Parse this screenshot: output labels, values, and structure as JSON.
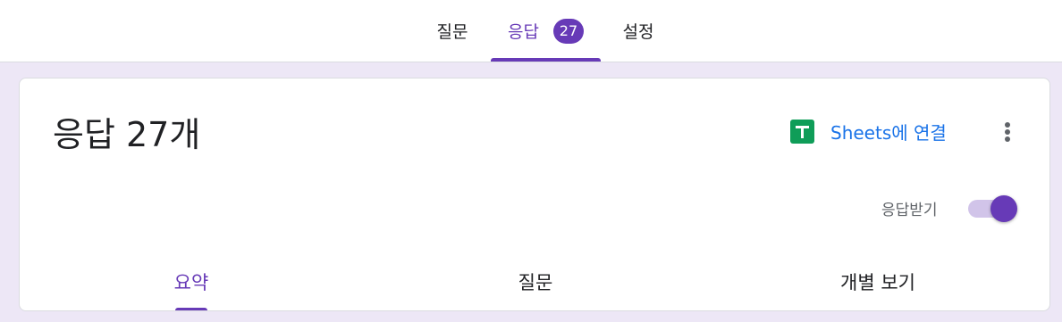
{
  "top_tabs": [
    {
      "label": "질문"
    },
    {
      "label": "응답",
      "badge": "27",
      "active": true
    },
    {
      "label": "설정"
    }
  ],
  "card": {
    "title": "응답 27개",
    "sheets_link": {
      "icon": "google-sheets-icon",
      "label": "Sheets에 연결"
    },
    "more_icon": "more-vert-icon",
    "accepting_label": "응답받기",
    "accepting_on": true
  },
  "sub_tabs": [
    {
      "label": "요약",
      "active": true
    },
    {
      "label": "질문"
    },
    {
      "label": "개별 보기"
    }
  ],
  "colors": {
    "accent": "#673ab7",
    "page_background": "#ede7f6",
    "link": "#1a73e8",
    "sheets_green": "#0f9d58",
    "toggle_track": "#d1c4e9"
  }
}
